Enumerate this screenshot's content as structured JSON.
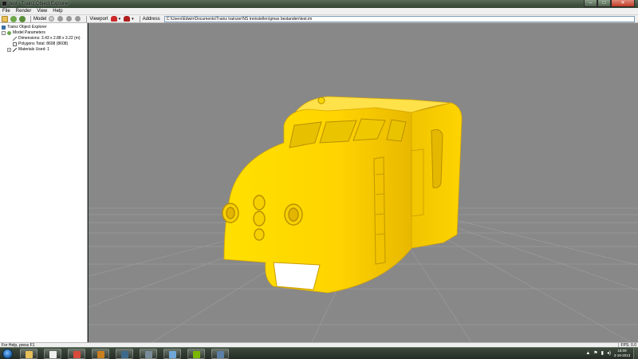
{
  "window": {
    "title": "test - Trainz Object Explorer",
    "controls": {
      "minimize": "–",
      "maximize": "□",
      "close": "✕"
    }
  },
  "menu": [
    "File",
    "Render",
    "View",
    "Help"
  ],
  "toolbar": {
    "model_label": "Model",
    "viewport_label": "Viewport",
    "address_label": "Address",
    "address_value": "C:\\Users\\Edwin\\Documents\\Trainz trainzer\\NS treinstellen\\gmax bestanden\\test.im",
    "dropdown_glyph": "▾",
    "icons": [
      "open-icon",
      "back-icon",
      "forward-icon",
      "light-icon",
      "grey-icon",
      "grey-icon",
      "grey-icon"
    ]
  },
  "tree": {
    "root": "Trainz Object Explorer",
    "model_parameters": "Model Parameters",
    "dimensions": "Dimensions: 3.43 x 2.88 x 3.22 (m)",
    "polygons": "Polygons Total: 8608 (8608)",
    "materials": "Materials Used: 1",
    "expand_glyph": "-",
    "collapse_glyph": "+"
  },
  "status": {
    "help": "For Help, press F1",
    "fps": "FPS: 0.0"
  },
  "taskbar": {
    "apps": [
      {
        "name": "file-explorer",
        "color": "#e8c15a"
      },
      {
        "name": "media-player",
        "color": "#f0f0f0"
      },
      {
        "name": "chrome",
        "color": "#d94a3a"
      },
      {
        "name": "trainz",
        "color": "#c8801e"
      },
      {
        "name": "app-5",
        "color": "#3d6a8c"
      },
      {
        "name": "app-6",
        "color": "#7a8c9a"
      },
      {
        "name": "app-7",
        "color": "#6fa8d8"
      },
      {
        "name": "spotify",
        "color": "#7ab800"
      },
      {
        "name": "trainz-object-explorer",
        "color": "#5b7fa6"
      }
    ],
    "tray": {
      "arrow": "▲",
      "flag": "⚑",
      "network": "▮",
      "volume": "◂)"
    },
    "time": "18:09",
    "date": "3-19-2013"
  },
  "colors": {
    "model": "#ffd200",
    "model_shadow": "#d9ac00",
    "viewport_bg": "#888888",
    "grid": "#9a9a9a"
  }
}
